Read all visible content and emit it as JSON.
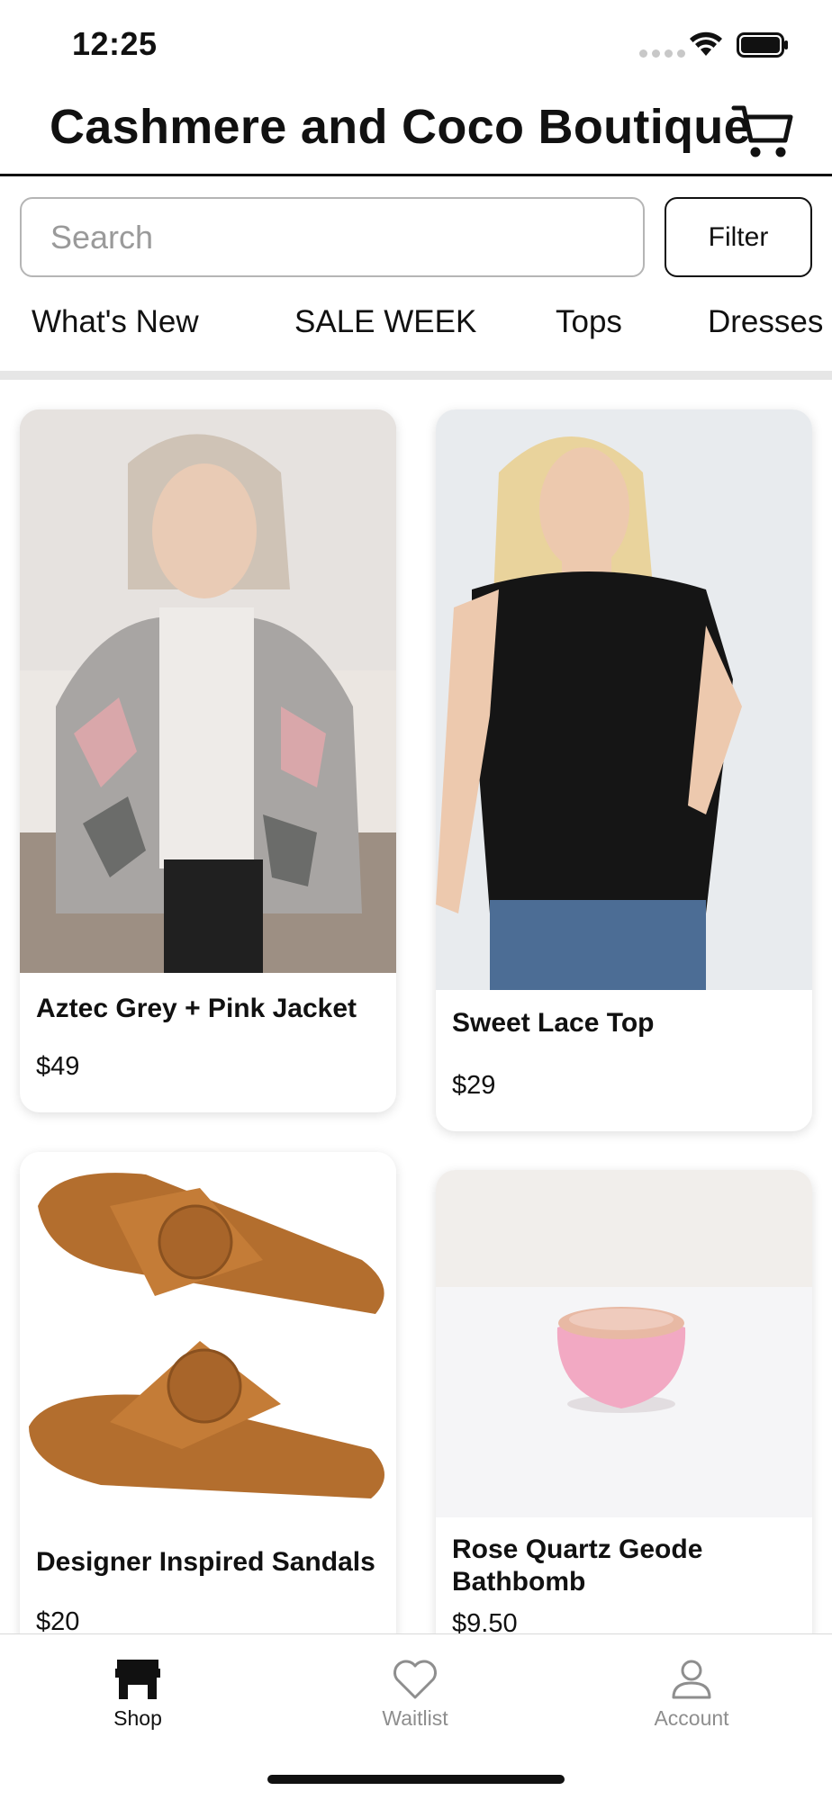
{
  "status_bar": {
    "time": "12:25"
  },
  "header": {
    "title": "Cashmere and Coco Boutique"
  },
  "search": {
    "placeholder": "Search",
    "value": ""
  },
  "filter": {
    "label": "Filter"
  },
  "categories": [
    "What's New",
    "SALE WEEK",
    "Tops",
    "Dresses"
  ],
  "products": [
    {
      "name": "Aztec Grey + Pink Jacket",
      "price": "$49"
    },
    {
      "name": "Sweet Lace Top",
      "price": "$29"
    },
    {
      "name": "Designer Inspired Sandals",
      "price": "$20"
    },
    {
      "name": "Rose Quartz Geode Bathbomb",
      "price": "$9.50"
    }
  ],
  "tab_bar": {
    "items": [
      {
        "label": "Shop",
        "icon": "store-icon",
        "active": true
      },
      {
        "label": "Waitlist",
        "icon": "heart-icon",
        "active": false
      },
      {
        "label": "Account",
        "icon": "person-icon",
        "active": false
      }
    ]
  },
  "colors": {
    "text": "#111111",
    "inactive": "#8e8e8e",
    "divider": "#e6e6e6"
  }
}
